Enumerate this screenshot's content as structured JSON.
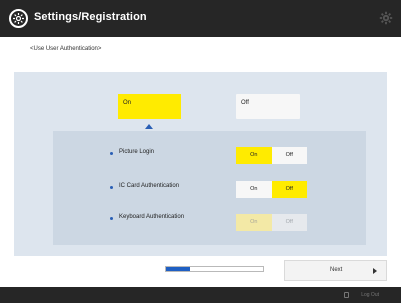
{
  "title_bar": {
    "title": "Settings/Registration",
    "icon": "settings-registration-icon",
    "gear_icon": "gear-icon"
  },
  "subtitle": "<Use User Authentication>",
  "main_choice": {
    "on_label": "On",
    "off_label": "Off",
    "selected": "On"
  },
  "options": [
    {
      "label": "Picture Login",
      "on_label": "On",
      "off_label": "Off",
      "selected": "On",
      "enabled": true
    },
    {
      "label": "IC Card Authentication",
      "on_label": "On",
      "off_label": "Off",
      "selected": "Off",
      "enabled": true
    },
    {
      "label": "Keyboard Authentication",
      "on_label": "On",
      "off_label": "Off",
      "selected": "On",
      "enabled": false
    }
  ],
  "progress": {
    "value": 0.25
  },
  "next_button": {
    "label": "Next"
  },
  "footer": {
    "logout_label": "Log Out"
  },
  "colors": {
    "accent": "#ffeb00",
    "bar": "#262626",
    "panel": "#dde5ee",
    "subpanel": "#ccd7e3",
    "progress": "#1f5fc3"
  }
}
